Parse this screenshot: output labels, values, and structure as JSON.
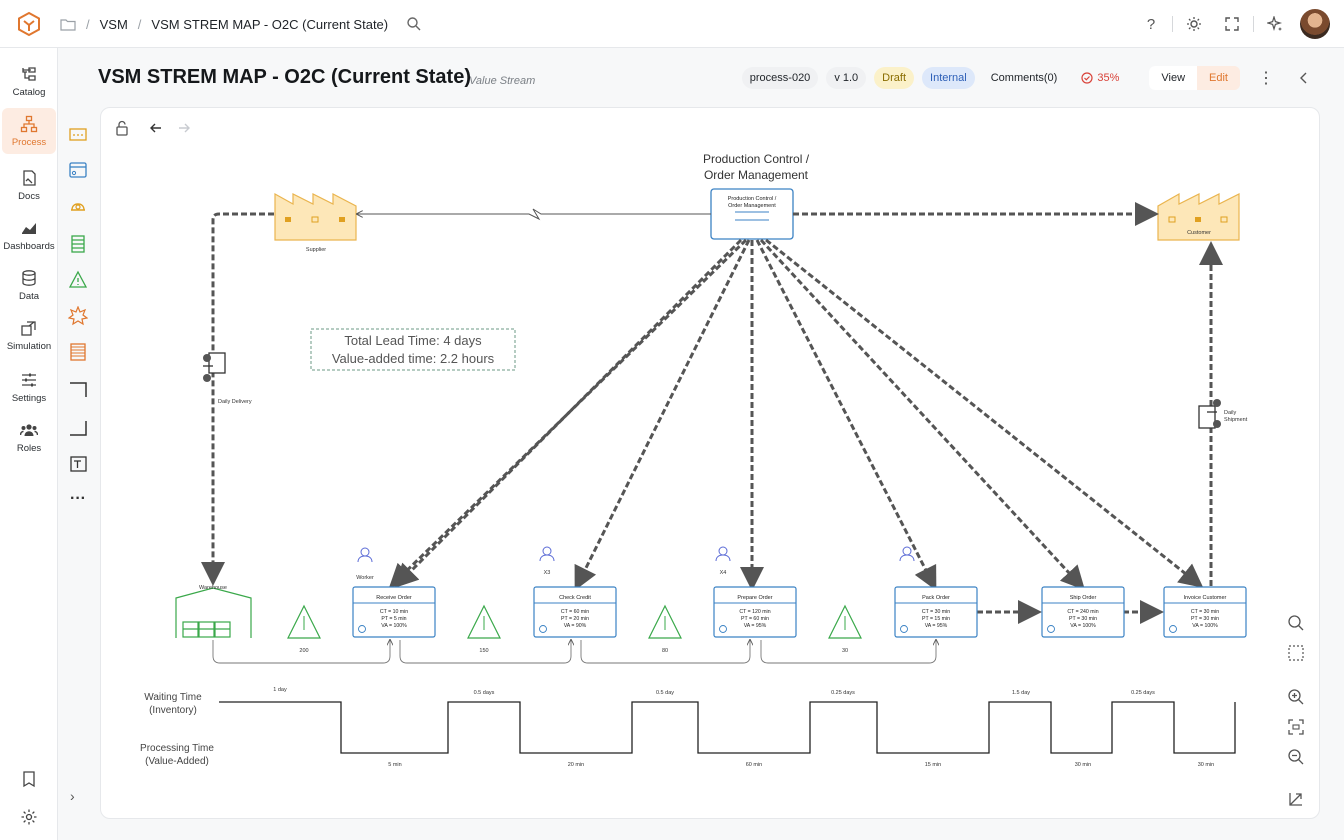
{
  "breadcrumb": {
    "section": "VSM",
    "page": "VSM STREM MAP - O2C (Current State)"
  },
  "nav": [
    {
      "label": "Catalog",
      "icon": "catalog-icon"
    },
    {
      "label": "Process",
      "icon": "process-icon",
      "active": true
    },
    {
      "label": "Docs",
      "icon": "docs-icon"
    },
    {
      "label": "Dashboards",
      "icon": "dashboards-icon"
    },
    {
      "label": "Data",
      "icon": "data-icon"
    },
    {
      "label": "Simulation",
      "icon": "simulation-icon"
    },
    {
      "label": "Settings",
      "icon": "settings-icon"
    },
    {
      "label": "Roles",
      "icon": "roles-icon"
    }
  ],
  "header": {
    "title": "VSM STREM MAP - O2C (Current State)",
    "type": "Value Stream",
    "id": "process-020",
    "version": "v 1.0",
    "status": "Draft",
    "visibility": "Internal",
    "comments": "Comments(0)",
    "completion": "35%",
    "view_label": "View",
    "edit_label": "Edit"
  },
  "map": {
    "production_control_title": [
      "Production Control /",
      "Order Management"
    ],
    "production_control_box": [
      "Production Control /",
      "Order Management"
    ],
    "supplier": "Supplier",
    "customer": "Customer",
    "daily_delivery": "Daily Delivery",
    "daily_shipment": [
      "Daily",
      "Shipment"
    ],
    "warehouse": "Warehouse",
    "lead_time": "Total Lead Time: 4 days",
    "value_added_time": "Value-added time: 2.2 hours",
    "operators": [
      {
        "label": "Worker"
      },
      {
        "label": "X3"
      },
      {
        "label": "X4"
      },
      {
        "label": ""
      }
    ],
    "processes": [
      {
        "name": "Receive Order",
        "ct": "CT = 10 min",
        "pt": "PT = 5 min",
        "va": "VA = 100%"
      },
      {
        "name": "Check Credit",
        "ct": "CT = 60 min",
        "pt": "PT = 20 min",
        "va": "VA = 90%"
      },
      {
        "name": "Prepare Order",
        "ct": "CT = 120 min",
        "pt": "PT = 60 min",
        "va": "VA = 95%"
      },
      {
        "name": "Pack Order",
        "ct": "CT = 30 min",
        "pt": "PT = 15 min",
        "va": "VA = 95%"
      },
      {
        "name": "Ship Order",
        "ct": "CT = 240 min",
        "pt": "PT = 30 min",
        "va": "VA = 100%"
      },
      {
        "name": "Invoice Customer",
        "ct": "CT = 30 min",
        "pt": "PT = 30 min",
        "va": "VA = 100%"
      }
    ],
    "inventory": [
      "200",
      "150",
      "80",
      "30"
    ],
    "timeline": {
      "waiting_label": [
        "Waiting Time",
        "(Inventory)"
      ],
      "processing_label": [
        "Processing Time",
        "(Value-Added)"
      ],
      "waits": [
        "1 day",
        "0.5 days",
        "0.5 day",
        "0.25 days",
        "1.5 day",
        "0.25 days"
      ],
      "processing": [
        "5 min",
        "20 min",
        "60 min",
        "15 min",
        "30 min",
        "30 min"
      ]
    }
  },
  "colors": {
    "accent": "#e0772f",
    "factory": "#fde7b8",
    "factory_stroke": "#eab54f",
    "process_stroke": "#3b82c4",
    "inventory": "#3aa84a"
  }
}
